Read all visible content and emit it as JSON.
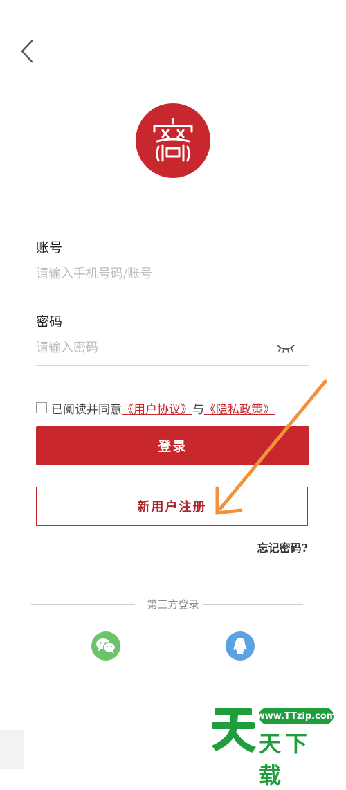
{
  "header": {
    "back_icon": "chevron-left-icon"
  },
  "logo": {
    "icon": "seal-logo",
    "color": "#c8282d"
  },
  "account": {
    "label": "账号",
    "placeholder": "请输入手机号码/账号"
  },
  "password": {
    "label": "密码",
    "placeholder": "请输入密码",
    "toggle_icon": "eye-closed-icon"
  },
  "agreement": {
    "prefix": "已阅读并同意",
    "user_agreement": "《用户协议》",
    "conjunction": "与",
    "privacy_policy": "《隐私政策》",
    "checked": false
  },
  "login_button": "登录",
  "register_button": "新用户注册",
  "forgot_password": "忘记密码?",
  "third_party": {
    "title": "第三方登录",
    "providers": [
      "wechat-icon",
      "qq-icon"
    ]
  },
  "watermark": {
    "url": "www.TTzip.com",
    "name": "天下载"
  },
  "colors": {
    "primary": "#c8282d",
    "wechat": "#6cc46a",
    "qq": "#5aa3e0",
    "annotation_arrow": "#f2923a",
    "watermark": "#1f9e3d"
  }
}
